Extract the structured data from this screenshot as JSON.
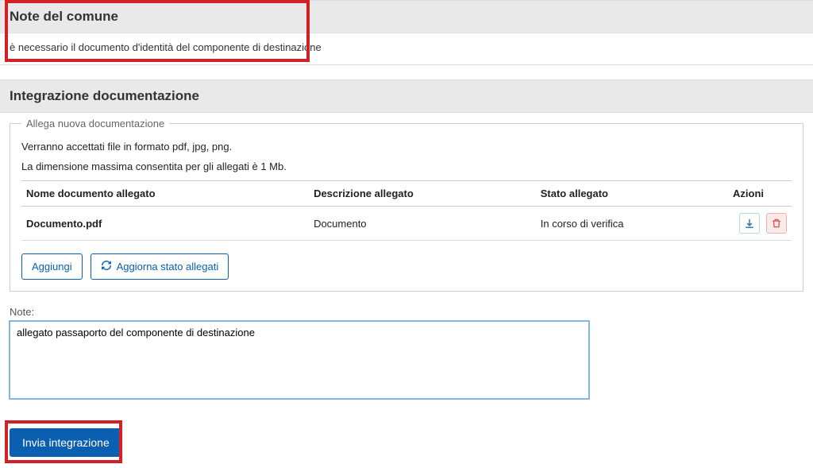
{
  "note_del_comune": {
    "title": "Note del comune",
    "message": "è necessario il documento d'identità del componente di destinazione"
  },
  "integrazione": {
    "title": "Integrazione documentazione",
    "fieldset_legend": "Allega nuova documentazione",
    "hint_formats": "Verranno accettati file in formato pdf, jpg, png.",
    "hint_size": "La dimensione massima consentita per gli allegati è 1 Mb.",
    "table": {
      "headers": {
        "name": "Nome documento allegato",
        "desc": "Descrizione allegato",
        "state": "Stato allegato",
        "actions": "Azioni"
      },
      "rows": [
        {
          "name": "Documento.pdf",
          "desc": "Documento",
          "state": "In corso di verifica"
        }
      ]
    },
    "buttons": {
      "add": "Aggiungi",
      "refresh": "Aggiorna stato allegati"
    }
  },
  "note_field": {
    "label": "Note:",
    "value": "allegato passaporto del componente di destinazione"
  },
  "submit": {
    "label": "Invia integrazione"
  }
}
